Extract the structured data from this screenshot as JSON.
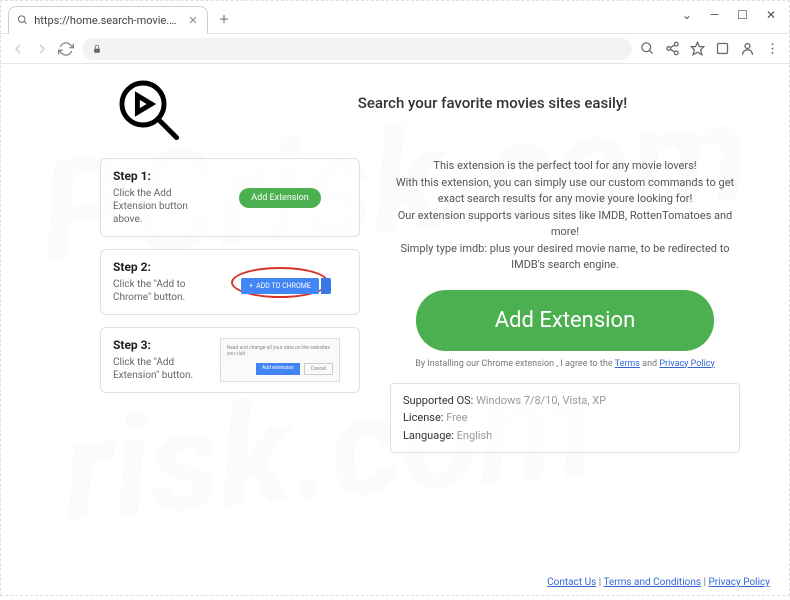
{
  "browser": {
    "url": "https://home.search-movie.com",
    "tab_title": "https://home.search-movie.com"
  },
  "page": {
    "headline": "Search your favorite movies sites easily!",
    "promo": {
      "l1": "This extension is the perfect tool for any movie lovers!",
      "l2": "With this extension, you can simply use our custom commands to get exact search results for any movie youre looking for!",
      "l3": "Our extension supports various sites like IMDB, RottenTomatoes and more!",
      "l4": "Simply type imdb: plus your desired movie name, to be redirected to IMDB's search engine."
    },
    "big_button": "Add Extension",
    "agree_pre": "By Installing our Chrome extension , I agree to the ",
    "agree_terms": "Terms",
    "agree_and": " and ",
    "agree_privacy": "Privacy Policy",
    "info": {
      "os_k": "Supported OS:",
      "os_v": "Windows 7/8/10, Vista, XP",
      "lic_k": "License:",
      "lic_v": "Free",
      "lang_k": "Language:",
      "lang_v": "English"
    }
  },
  "steps": [
    {
      "title": "Step 1:",
      "desc": "Click the Add Extension button above.",
      "pill": "Add Extension"
    },
    {
      "title": "Step 2:",
      "desc": "Click the \"Add to Chrome\" button.",
      "btn": "ADD TO CHROME"
    },
    {
      "title": "Step 3:",
      "desc": "Click the \"Add Extension\" button.",
      "dlg_b1": "Add extension",
      "dlg_b2": "Cancel",
      "dlg_txt": "Read and change all your data on the websites you visit"
    }
  ],
  "footer": {
    "contact": "Contact Us",
    "terms": "Terms and Conditions",
    "privacy": "Privacy Policy",
    "sep": " | "
  }
}
